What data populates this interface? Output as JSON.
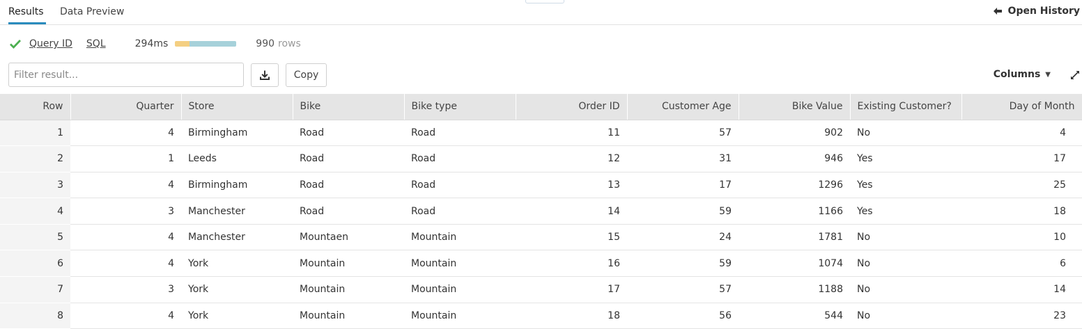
{
  "tabs": [
    {
      "label": "Results",
      "active": true
    },
    {
      "label": "Data Preview",
      "active": false
    }
  ],
  "open_history": {
    "label": "Open History"
  },
  "query_info": {
    "query_id_label": "Query ID",
    "sql_label": "SQL",
    "duration": "294ms",
    "progress": {
      "segment_a_fraction": 0.24,
      "segment_b_fraction": 0.76,
      "color_a": "#f4cf82",
      "color_b": "#a6d1da"
    },
    "row_count": "990",
    "rows_word": "rows",
    "status_icon": "check-icon",
    "status_color": "#4caf50"
  },
  "toolbar": {
    "filter_placeholder": "Filter result...",
    "download_icon": "download-icon",
    "copy_label": "Copy",
    "columns_label": "Columns",
    "expand_icon": "expand-icon"
  },
  "table": {
    "columns": [
      "Row",
      "Quarter",
      "Store",
      "Bike",
      "Bike type",
      "Order ID",
      "Customer Age",
      "Bike Value",
      "Existing Customer?",
      "Day of Month"
    ],
    "rows": [
      [
        "1",
        "4",
        "Birmingham",
        "Road",
        "Road",
        "11",
        "57",
        "902",
        "No",
        "4"
      ],
      [
        "2",
        "1",
        "Leeds",
        "Road",
        "Road",
        "12",
        "31",
        "946",
        "Yes",
        "17"
      ],
      [
        "3",
        "4",
        "Birmingham",
        "Road",
        "Road",
        "13",
        "17",
        "1296",
        "Yes",
        "25"
      ],
      [
        "4",
        "3",
        "Manchester",
        "Road",
        "Road",
        "14",
        "59",
        "1166",
        "Yes",
        "18"
      ],
      [
        "5",
        "4",
        "Manchester",
        "Mountaen",
        "Mountain",
        "15",
        "24",
        "1781",
        "No",
        "10"
      ],
      [
        "6",
        "4",
        "York",
        "Mountain",
        "Mountain",
        "16",
        "59",
        "1074",
        "No",
        "6"
      ],
      [
        "7",
        "3",
        "York",
        "Mountain",
        "Mountain",
        "17",
        "57",
        "1188",
        "No",
        "14"
      ],
      [
        "8",
        "4",
        "York",
        "Mountain",
        "Mountain",
        "18",
        "56",
        "544",
        "No",
        "23"
      ]
    ]
  },
  "colors": {
    "accent": "#2a8bbd",
    "header_bg": "#e5e5e5",
    "rownum_bg": "#f4f4f4"
  }
}
